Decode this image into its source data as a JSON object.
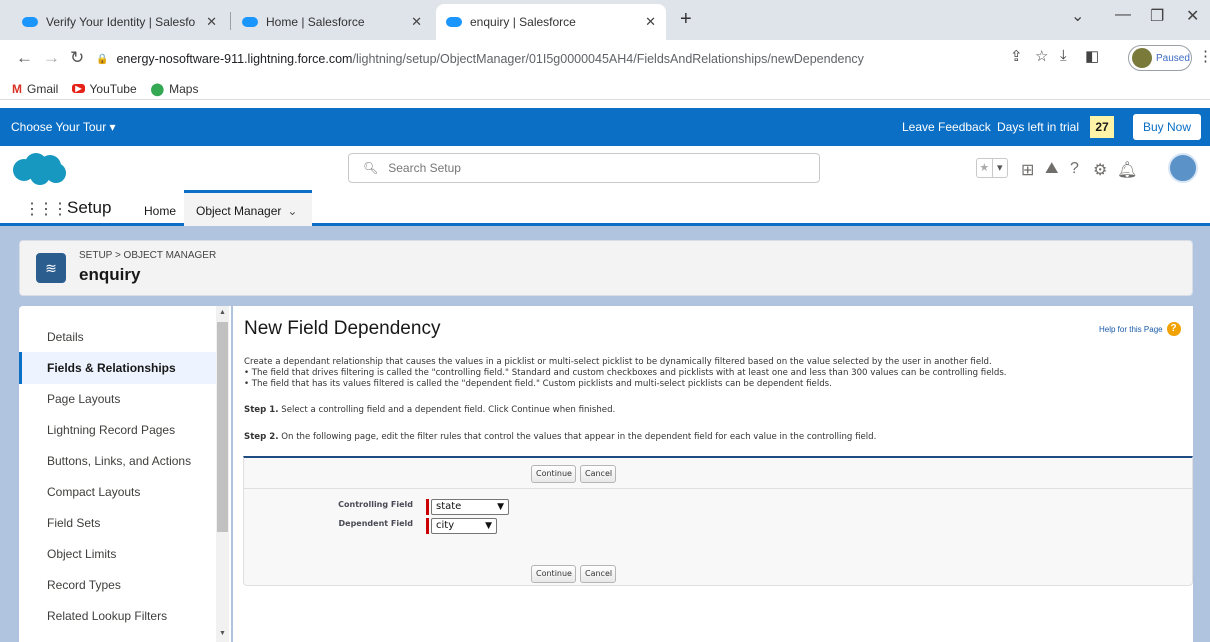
{
  "browser": {
    "tabs": [
      {
        "title": "Verify Your Identity | Salesforce"
      },
      {
        "title": "Home | Salesforce"
      },
      {
        "title": "enquiry | Salesforce"
      }
    ],
    "url_host": "energy-nosoftware-911.lightning.force.com",
    "url_path": "/lightning/setup/ObjectManager/01I5g0000045AH4/FieldsAndRelationships/newDependency",
    "profile_label": "Paused",
    "bookmarks": [
      {
        "label": "Gmail",
        "icon": "gmail-icon"
      },
      {
        "label": "YouTube",
        "icon": "youtube-icon"
      },
      {
        "label": "Maps",
        "icon": "maps-icon"
      }
    ]
  },
  "trial": {
    "choose_tour": "Choose Your Tour",
    "leave_feedback": "Leave Feedback",
    "days_left_label": "Days left in trial",
    "days_left": "27",
    "buy_now": "Buy Now"
  },
  "header": {
    "search_placeholder": "Search Setup"
  },
  "appnav": {
    "app_name": "Setup",
    "home": "Home",
    "object_manager": "Object Manager"
  },
  "page_header": {
    "breadcrumb": "SETUP > OBJECT MANAGER",
    "title": "enquiry"
  },
  "sidebar": {
    "items": [
      {
        "label": "Details"
      },
      {
        "label": "Fields & Relationships",
        "active": true
      },
      {
        "label": "Page Layouts"
      },
      {
        "label": "Lightning Record Pages"
      },
      {
        "label": "Buttons, Links, and Actions"
      },
      {
        "label": "Compact Layouts"
      },
      {
        "label": "Field Sets"
      },
      {
        "label": "Object Limits"
      },
      {
        "label": "Record Types"
      },
      {
        "label": "Related Lookup Filters"
      }
    ]
  },
  "main": {
    "title": "New Field Dependency",
    "help_link": "Help for this Page",
    "description": [
      "Create a dependant relationship that causes the values in a picklist or multi-select picklist to be dynamically filtered based on the value selected by the user in another field.",
      "• The field that drives filtering is called the \"controlling field.\" Standard and custom checkboxes and picklists with at least one and less than 300 values can be controlling fields.",
      "• The field that has its values filtered is called the \"dependent field.\" Custom picklists and multi-select picklists can be dependent fields."
    ],
    "step1_label": "Step 1.",
    "step1_text": "Select a controlling field and a dependent field. Click Continue when finished.",
    "step2_label": "Step 2.",
    "step2_text": "On the following page, edit the filter rules that control the values that appear in the dependent field for each value in the controlling field.",
    "continue_label": "Continue",
    "cancel_label": "Cancel",
    "controlling_field_label": "Controlling Field",
    "controlling_field_value": "state",
    "dependent_field_label": "Dependent Field",
    "dependent_field_value": "city"
  },
  "colors": {
    "brand_blue": "#0b6fc5",
    "required_red": "#cc0000",
    "trial_badge": "#fff3a8"
  }
}
